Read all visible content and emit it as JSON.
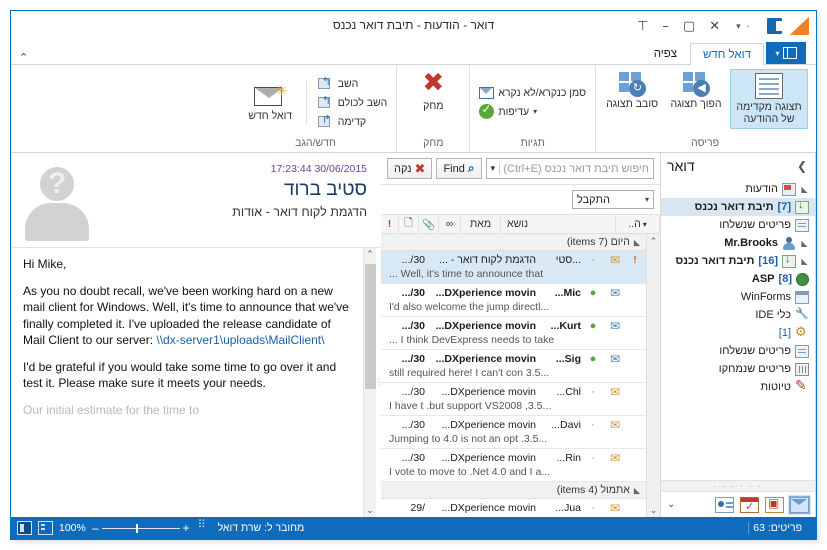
{
  "window": {
    "title": "דואר - הודעות - תיבת דואר נכנס",
    "logo_icon": "dx-logo-icon",
    "office_icon": "office-icon",
    "qat_caret": "▾",
    "controls": {
      "restore": "⊤",
      "minimize": "–",
      "maximize": "▢",
      "close": "✕"
    }
  },
  "ribbon": {
    "menu_caret": "▾",
    "tabs": [
      {
        "label": "דואל חדש",
        "active": true
      },
      {
        "label": "צפיה",
        "active": false
      }
    ],
    "collapse_caret": "⌃",
    "groups": [
      {
        "label": "חדש/הגב",
        "big_buttons": [
          {
            "label": "דואל חדש",
            "icon": "new-mail-icon"
          }
        ],
        "small_buttons": [
          {
            "label": "השב",
            "icon": "reply-icon"
          },
          {
            "label": "השב לכולם",
            "icon": "reply-all-icon"
          },
          {
            "label": "קדימה",
            "icon": "forward-icon"
          }
        ]
      },
      {
        "label": "מחק",
        "big_buttons": [
          {
            "label": "מחק",
            "icon": "delete-x-icon"
          }
        ],
        "small_buttons": []
      },
      {
        "label": "תגיות",
        "big_buttons": [],
        "small_buttons": [
          {
            "label": "סמן כנקרא/לא נקרא",
            "icon": "mark-read-icon"
          },
          {
            "label": "עדיפות",
            "icon": "priority-icon",
            "caret": "▾"
          }
        ]
      },
      {
        "label": "פריסה",
        "big_buttons": [
          {
            "label": "סובב תצוגה",
            "icon": "rotate-layout-icon"
          },
          {
            "label": "הפוך תצוגה",
            "icon": "flip-layout-icon"
          },
          {
            "label": "תצוגה מקדימה\nשל ההודעה",
            "icon": "reading-pane-icon",
            "selected": true
          }
        ],
        "small_buttons": []
      }
    ]
  },
  "navpane": {
    "title": "דואר",
    "expand_icon": "❯",
    "items": [
      {
        "label": "הודעות",
        "icon": "announcements-icon",
        "twisty": "◣",
        "count": "",
        "bold": false,
        "selected": false,
        "indent": 0
      },
      {
        "label": "תיבת דואר נכנס",
        "icon": "inbox-icon",
        "twisty": "",
        "count": "[7]",
        "bold": true,
        "selected": true,
        "indent": 1
      },
      {
        "label": "פריטים שנשלחו",
        "icon": "sent-icon",
        "twisty": "",
        "count": "",
        "bold": false,
        "selected": false,
        "indent": 1
      },
      {
        "label": "Mr.Brooks",
        "icon": "person-icon",
        "twisty": "◣",
        "count": "",
        "bold": true,
        "selected": false,
        "indent": 0
      },
      {
        "label": "תיבת דואר נכנס",
        "icon": "inbox-icon",
        "twisty": "◣",
        "count": "[16]",
        "bold": true,
        "selected": false,
        "indent": 0
      },
      {
        "label": "ASP",
        "icon": "globe-icon",
        "twisty": "",
        "count": "[8]",
        "bold": true,
        "selected": false,
        "indent": 1
      },
      {
        "label": "WinForms",
        "icon": "window-icon",
        "twisty": "",
        "count": "",
        "bold": false,
        "selected": false,
        "indent": 1
      },
      {
        "label": "כלי IDE",
        "icon": "wrench-icon",
        "twisty": "",
        "count": "",
        "bold": false,
        "selected": false,
        "indent": 1
      },
      {
        "label": "",
        "icon": "gear-icon",
        "twisty": "",
        "count": "[1]",
        "bold": false,
        "selected": false,
        "indent": 1
      },
      {
        "label": "פריטים שנשלחו",
        "icon": "sent-icon",
        "twisty": "",
        "count": "",
        "bold": false,
        "selected": false,
        "indent": 0
      },
      {
        "label": "פריטים שנמחקו",
        "icon": "trash-icon",
        "twisty": "",
        "count": "",
        "bold": false,
        "selected": false,
        "indent": 0
      },
      {
        "label": "טיוטות",
        "icon": "drafts-pencil-icon",
        "twisty": "",
        "count": "",
        "bold": false,
        "selected": false,
        "indent": 0
      }
    ],
    "grip": "· · · · · ·",
    "modules": [
      {
        "name": "mail-module-icon",
        "active": true
      },
      {
        "name": "tasks-module-icon",
        "active": false
      },
      {
        "name": "calendar-module-icon",
        "active": false
      },
      {
        "name": "people-module-icon",
        "active": false
      }
    ],
    "more_caret": "⌄"
  },
  "msglist": {
    "search": {
      "placeholder": "חיפוש תיבת דואר נכנס (Ctrl+E)",
      "dropdown_caret": "▾",
      "find_label": "Find",
      "find_icon": "search-icon",
      "clear_label": "נקה",
      "clear_icon": "clear-x-icon"
    },
    "filter": {
      "value": "התקבל",
      "caret": "▾"
    },
    "columns": {
      "importance": "!",
      "icon": "icon-column",
      "attachment": "attachment-column",
      "link": "flag-column",
      "from": "מאת",
      "subject": "נושא",
      "date": "ה..",
      "date_caret": "▾"
    },
    "groups": [
      {
        "header": "היום (7 items)",
        "twisty": "◣",
        "rows": [
          {
            "importance": "!",
            "env": "open",
            "dot": "·",
            "from": "...סטי",
            "subject": "הדגמת לקוח דואר - ...",
            "date": "30/...",
            "preview": "... Well, it's time to announce that",
            "unread": false,
            "selected": true
          },
          {
            "importance": "",
            "env": "closed",
            "dot": "●",
            "from": "Mic...",
            "subject": "DXperience movin...",
            "date": "30/...",
            "preview": "I'd also welcome the jump directl...",
            "unread": true,
            "selected": false
          },
          {
            "importance": "",
            "env": "closed",
            "dot": "●",
            "from": "Kurt...",
            "subject": "DXperience movin...",
            "date": "30/...",
            "preview": "... I think DevExpress needs to take",
            "unread": true,
            "selected": false
          },
          {
            "importance": "",
            "env": "closed",
            "dot": "●",
            "from": "Sig...",
            "subject": "DXperience movin...",
            "date": "30/...",
            "preview": "still required here! I can't con 3.5...",
            "unread": true,
            "selected": false
          },
          {
            "importance": "",
            "env": "open",
            "dot": "·",
            "from": "Chl...",
            "subject": "DXperience movin...",
            "date": "30/...",
            "preview": "I have t .but support VS2008 ,3.5...",
            "unread": false,
            "selected": false
          },
          {
            "importance": "",
            "env": "open",
            "dot": "·",
            "from": "Davi...",
            "subject": "DXperience movin...",
            "date": "30/...",
            "preview": "Jumping to 4.0 is not an opt .3.5...",
            "unread": false,
            "selected": false
          },
          {
            "importance": "",
            "env": "open",
            "dot": "·",
            "from": "Rin...",
            "subject": "DXperience movin...",
            "date": "30/...",
            "preview": "I vote to move to .Net 4.0 and I a...",
            "unread": false,
            "selected": false
          }
        ]
      },
      {
        "header": "אתמול (4 items)",
        "twisty": "◣",
        "rows": [
          {
            "importance": "",
            "env": "open",
            "dot": "·",
            "from": "Jua...",
            "subject": "DXperience movin...",
            "date": "/29",
            "preview": "",
            "unread": false,
            "selected": false
          }
        ]
      }
    ],
    "scroll_up": "⌃",
    "scroll_down": "⌄"
  },
  "readpane": {
    "avatar_icon": "unknown-contact-avatar",
    "date": "17:23:44 30/06/2015",
    "sender": "סטיב ברוד",
    "subject": "הדגמת לקוח דואר - אודות",
    "body_paragraphs": [
      "Hi Mike,",
      "As you no doubt recall, we've been working hard on a new mail client for Windows. Well, it's time to announce that we've finally completed it. I've uploaded the release candidate of Mail Client to our server: \\\\dx-server1\\uploads\\MailClient\\",
      "I'd be grateful if you would take some time to go over it and test it. Please make sure it meets your needs.",
      "Our initial estimate for the time to"
    ],
    "link_text": "\\\\dx-server1\\uploads\\MailClient\\",
    "scroll_up": "⌃",
    "scroll_down": "⌄",
    "splitter": "⋮"
  },
  "statusbar": {
    "items_label": "פריטים: 63",
    "connection": "מחובר ל: שרת דואל",
    "zoom": "100%",
    "zoom_minus": "–",
    "zoom_plus": "+",
    "view_normal_icon": "normal-view-icon",
    "view_reading_icon": "reading-view-icon",
    "resize_grip": "resize-grip-icon"
  },
  "colors": {
    "accent": "#0f6cbd",
    "selection": "#d8e8f5",
    "frame": "#0072c6"
  }
}
